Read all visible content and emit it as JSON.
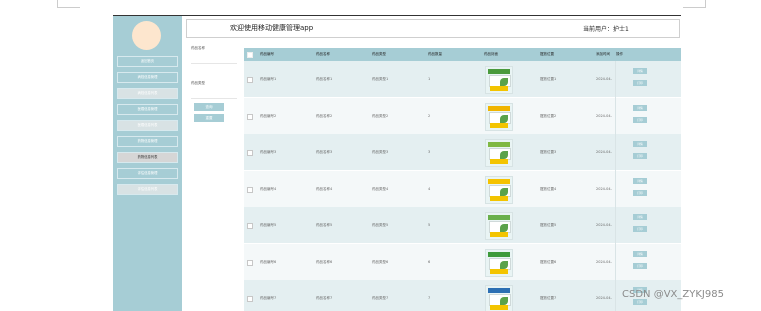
{
  "header": {
    "app_title": "欢迎使用移动健康管理app",
    "current_user": "当前用户：护士1"
  },
  "sidebar": {
    "items": [
      {
        "label": "返回首页"
      },
      {
        "label": "病档信息管理"
      },
      {
        "label": "病档信息列表"
      },
      {
        "label": "医嘱信息管理"
      },
      {
        "label": "医嘱信息列表"
      },
      {
        "label": "药物信息管理"
      },
      {
        "label": "药物信息列表"
      },
      {
        "label": "评估信息管理"
      },
      {
        "label": "评估信息列表"
      }
    ],
    "active_index": 6
  },
  "search": {
    "name_label": "药品名称",
    "name_placeholder": "",
    "type_label": "药品类型",
    "type_placeholder": "",
    "query_label": "查询",
    "reset_label": "重置"
  },
  "table": {
    "columns": [
      "药品编号",
      "药品名称",
      "药品类型",
      "药品数量",
      "药品封面",
      "摆放位置",
      "添加时间",
      "操作"
    ],
    "rows": [
      {
        "code": "药品编号1",
        "name": "药品名称1",
        "type": "药品类型1",
        "qty": "1",
        "location": "摆放位置1",
        "time": "2024-04-",
        "image": "medicine-box-icon"
      },
      {
        "code": "药品编号2",
        "name": "药品名称2",
        "type": "药品类型2",
        "qty": "2",
        "location": "摆放位置2",
        "time": "2024-04-",
        "image": "medicine-box-icon"
      },
      {
        "code": "药品编号3",
        "name": "药品名称3",
        "type": "药品类型3",
        "qty": "3",
        "location": "摆放位置3",
        "time": "2024-04-",
        "image": "medicine-box-icon"
      },
      {
        "code": "药品编号4",
        "name": "药品名称4",
        "type": "药品类型4",
        "qty": "4",
        "location": "摆放位置4",
        "time": "2024-04-",
        "image": "medicine-box-icon"
      },
      {
        "code": "药品编号5",
        "name": "药品名称5",
        "type": "药品类型5",
        "qty": "5",
        "location": "摆放位置5",
        "time": "2024-04-",
        "image": "medicine-box-icon"
      },
      {
        "code": "药品编号6",
        "name": "药品名称6",
        "type": "药品类型6",
        "qty": "6",
        "location": "摆放位置6",
        "time": "2024-04-",
        "image": "medicine-box-icon"
      },
      {
        "code": "药品编号7",
        "name": "药品名称7",
        "type": "药品类型7",
        "qty": "7",
        "location": "摆放位置7",
        "time": "2024-04-",
        "image": "medicine-box-icon"
      }
    ],
    "action_detail_label": "详情",
    "action_print_label": "打印"
  },
  "watermark": "CSDN @VX_ZYKJ985",
  "colors": {
    "accent": "#a6cdd5",
    "avatar": "#fde6ce",
    "row_odd": "#e4eff1",
    "row_even": "#f4f8f9"
  }
}
